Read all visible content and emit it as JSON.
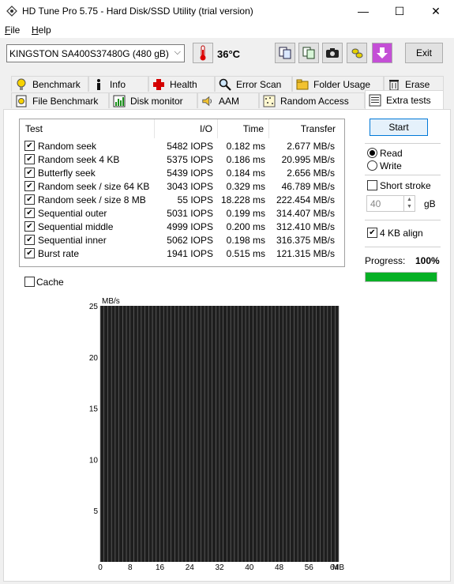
{
  "window": {
    "title": "HD Tune Pro 5.75 - Hard Disk/SSD Utility (trial version)",
    "controls": {
      "minimize": "—",
      "maximize": "☐",
      "close": "✕"
    }
  },
  "menu": [
    {
      "underline": "F",
      "rest": "ile"
    },
    {
      "underline": "H",
      "rest": "elp"
    }
  ],
  "toolbar": {
    "drive": "KINGSTON SA400S37480G (480 gB)",
    "temperature": "36°C",
    "exit_label": "Exit",
    "icons": [
      "thermometer-icon",
      "copy-info-icon",
      "copy-all-icon",
      "camera-icon",
      "bugs-icon",
      "download-icon"
    ]
  },
  "tabs": {
    "row1": [
      {
        "label": "Benchmark",
        "icon": "benchmark-icon"
      },
      {
        "label": "Info",
        "icon": "info-icon"
      },
      {
        "label": "Health",
        "icon": "health-cross-icon"
      },
      {
        "label": "Error Scan",
        "icon": "magnifier-icon"
      },
      {
        "label": "Folder Usage",
        "icon": "folder-icon"
      },
      {
        "label": "Erase",
        "icon": "trash-icon"
      }
    ],
    "row2": [
      {
        "label": "File Benchmark",
        "icon": "file-benchmark-icon"
      },
      {
        "label": "Disk monitor",
        "icon": "disk-monitor-icon"
      },
      {
        "label": "AAM",
        "icon": "speaker-icon"
      },
      {
        "label": "Random Access",
        "icon": "random-access-icon"
      },
      {
        "label": "Extra tests",
        "icon": "extra-tests-icon",
        "active": true
      }
    ]
  },
  "table": {
    "headers": {
      "test": "Test",
      "io": "I/O",
      "time": "Time",
      "transfer": "Transfer"
    },
    "rows": [
      {
        "name": "Random seek",
        "io": "5482 IOPS",
        "time": "0.182 ms",
        "transfer": "2.677 MB/s",
        "checked": true
      },
      {
        "name": "Random seek 4 KB",
        "io": "5375 IOPS",
        "time": "0.186 ms",
        "transfer": "20.995 MB/s",
        "checked": true
      },
      {
        "name": "Butterfly seek",
        "io": "5439 IOPS",
        "time": "0.184 ms",
        "transfer": "2.656 MB/s",
        "checked": true
      },
      {
        "name": "Random seek / size 64 KB",
        "io": "3043 IOPS",
        "time": "0.329 ms",
        "transfer": "46.789 MB/s",
        "checked": true
      },
      {
        "name": "Random seek / size 8 MB",
        "io": "55 IOPS",
        "time": "18.228 ms",
        "transfer": "222.454 MB/s",
        "checked": true
      },
      {
        "name": "Sequential outer",
        "io": "5031 IOPS",
        "time": "0.199 ms",
        "transfer": "314.407 MB/s",
        "checked": true
      },
      {
        "name": "Sequential middle",
        "io": "4999 IOPS",
        "time": "0.200 ms",
        "transfer": "312.410 MB/s",
        "checked": true
      },
      {
        "name": "Sequential inner",
        "io": "5062 IOPS",
        "time": "0.198 ms",
        "transfer": "316.375 MB/s",
        "checked": true
      },
      {
        "name": "Burst rate",
        "io": "1941 IOPS",
        "time": "0.515 ms",
        "transfer": "121.315 MB/s",
        "checked": true
      }
    ]
  },
  "cache": {
    "label": "Cache",
    "checked": false
  },
  "right_panel": {
    "start_label": "Start",
    "read_label": "Read",
    "write_label": "Write",
    "mode_selected": "Read",
    "short_stroke_label": "Short stroke",
    "short_stroke_checked": false,
    "short_stroke_value": "40",
    "short_stroke_unit": "gB",
    "align_label": "4 KB align",
    "align_checked": true,
    "progress_label": "Progress:",
    "progress_text": "100%",
    "progress_fraction": 1.0
  },
  "colors": {
    "progress_green": "#06b025",
    "chart_bg": "#1e1e1e",
    "chart_grid": "#7a7a7a",
    "accent_blue": "#0078d7"
  },
  "chart_data": {
    "type": "line",
    "title": "",
    "xlabel": "MB",
    "ylabel": "MB/s",
    "x_ticks": [
      "0",
      "8",
      "16",
      "24",
      "32",
      "40",
      "48",
      "56",
      "64"
    ],
    "y_ticks": [
      "25",
      "20",
      "15",
      "10",
      "5"
    ],
    "xlim": [
      0,
      64
    ],
    "ylim": [
      0,
      25
    ],
    "grid": true,
    "series": []
  }
}
